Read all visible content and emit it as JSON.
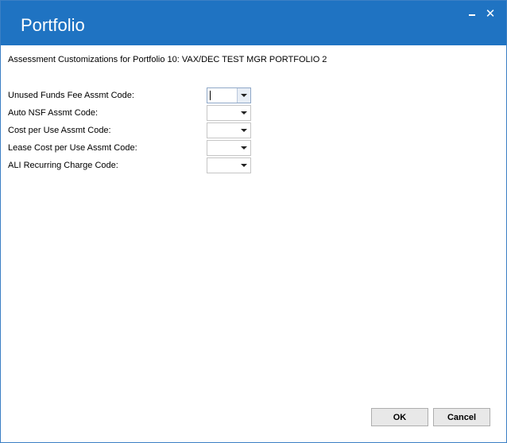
{
  "window": {
    "title": "Portfolio",
    "minimize_glyph": "_",
    "close_glyph": "✕"
  },
  "subtitle": "Assessment Customizations for Portfolio 10: VAX/DEC TEST MGR PORTFOLIO 2",
  "fields": [
    {
      "label": "Unused Funds Fee Assmt Code:",
      "value": ""
    },
    {
      "label": "Auto NSF Assmt Code:",
      "value": ""
    },
    {
      "label": "Cost per Use Assmt Code:",
      "value": ""
    },
    {
      "label": "Lease Cost per Use Assmt Code:",
      "value": ""
    },
    {
      "label": "ALI Recurring Charge Code:",
      "value": ""
    }
  ],
  "buttons": {
    "ok": "OK",
    "cancel": "Cancel"
  },
  "colors": {
    "titlebar": "#1f73c2",
    "title_text": "#ffffff"
  }
}
